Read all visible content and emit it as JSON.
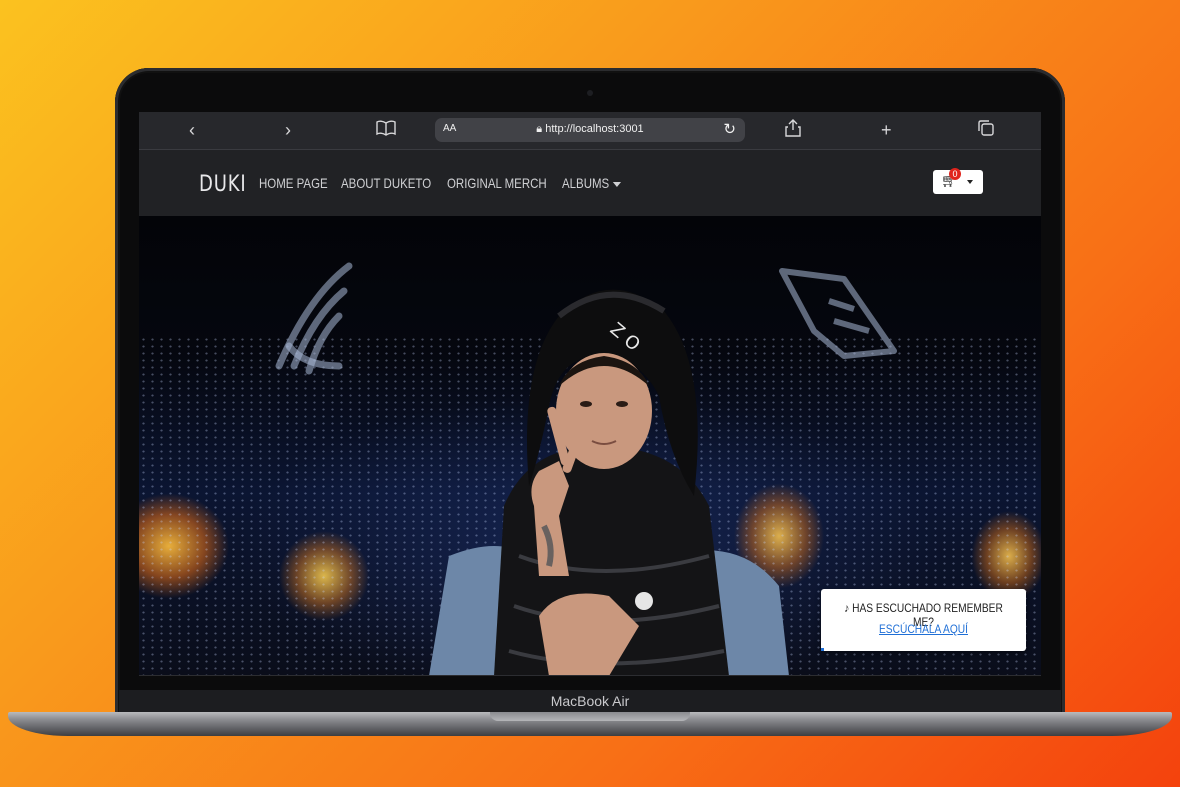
{
  "browser": {
    "url": "http://localhost:3001",
    "text_size_label": "AA",
    "icons": [
      "back-icon",
      "forward-icon",
      "bookmarks-icon",
      "reload-icon",
      "share-icon",
      "new-tab-icon",
      "tabs-icon"
    ]
  },
  "site": {
    "brand": "DUKI",
    "nav": [
      {
        "label": "HOME PAGE"
      },
      {
        "label": "ABOUT DUKETO"
      },
      {
        "label": "ORIGINAL MERCH"
      },
      {
        "label": "ALBUMS"
      }
    ],
    "cart_count": "0"
  },
  "promo": {
    "text": "HAS ESCUCHADO REMEMBER ME?",
    "link": "ESCÚCHALA AQUÍ"
  },
  "device": {
    "label": "MacBook Air"
  },
  "colors": {
    "background_start": "#fbc21f",
    "background_end": "#f4420d",
    "navbar": "#212225",
    "badge": "#e0241c",
    "link": "#1f6fd6"
  }
}
